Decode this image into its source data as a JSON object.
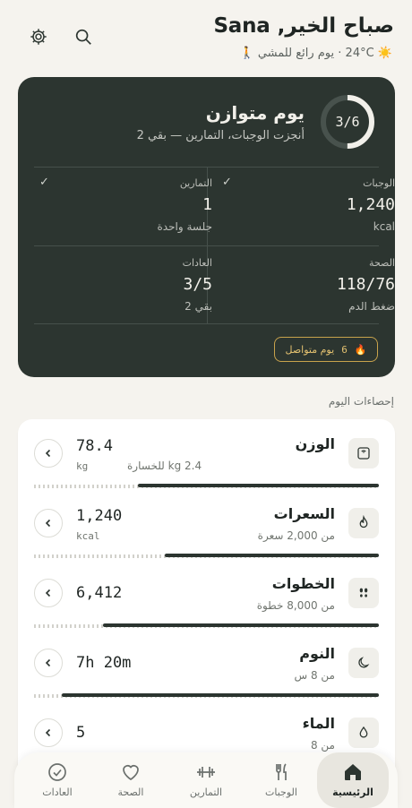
{
  "header": {
    "greeting": "صباح الخير, Sana",
    "weather": "☀️ 24°C · يوم رائع للمشي 🚶"
  },
  "summary": {
    "progress_text": "3/6",
    "progress": 0.5,
    "title": "يوم متوازن",
    "subtitle": "أنجزت الوجبات، التمارين — بقي 2",
    "cells": [
      {
        "label": "الوجبات",
        "value": "1,240",
        "unit": "kcal",
        "checked": true
      },
      {
        "label": "التمارين",
        "value": "1",
        "unit": "جلسة واحدة",
        "checked": true
      },
      {
        "label": "الصحة",
        "value": "118/76",
        "unit": "ضغط الدم",
        "checked": false
      },
      {
        "label": "العادات",
        "value": "3/5",
        "unit": "بقي 2",
        "checked": false
      }
    ],
    "streak": {
      "count": "6",
      "label": "يوم متواصل"
    }
  },
  "section_label": "إحصاءات اليوم",
  "stats": [
    {
      "icon": "scale-icon",
      "title": "الوزن",
      "subtitle": "",
      "value": "78.4",
      "unit": "kg",
      "extra": "2.4 kg للخسارة",
      "progress": 0.7
    },
    {
      "icon": "flame-icon",
      "title": "السعرات",
      "subtitle": "من 2,000 سعرة",
      "value": "1,240",
      "unit": "kcal",
      "extra": "",
      "progress": 0.62
    },
    {
      "icon": "footprints-icon",
      "title": "الخطوات",
      "subtitle": "من 8,000 خطوة",
      "value": "6,412",
      "unit": "",
      "extra": "",
      "progress": 0.8
    },
    {
      "icon": "moon-icon",
      "title": "النوم",
      "subtitle": "من 8 س",
      "value": "7h 20m",
      "unit": "",
      "extra": "",
      "progress": 0.92
    },
    {
      "icon": "drop-icon",
      "title": "الماء",
      "subtitle": "من 8",
      "value": "5",
      "unit": "",
      "extra": "",
      "progress": 0.62
    }
  ],
  "nav": [
    {
      "label": "الرئيسية",
      "icon": "home-icon",
      "active": true
    },
    {
      "label": "الوجبات",
      "icon": "fork-knife-icon",
      "active": false
    },
    {
      "label": "التمارين",
      "icon": "dumbbell-icon",
      "active": false
    },
    {
      "label": "الصحة",
      "icon": "heart-icon",
      "active": false
    },
    {
      "label": "العادات",
      "icon": "check-circle-icon",
      "active": false
    }
  ],
  "colors": {
    "card": "#2c3530",
    "background": "#f5f3ee",
    "accent_gold": "#c7a24c"
  }
}
